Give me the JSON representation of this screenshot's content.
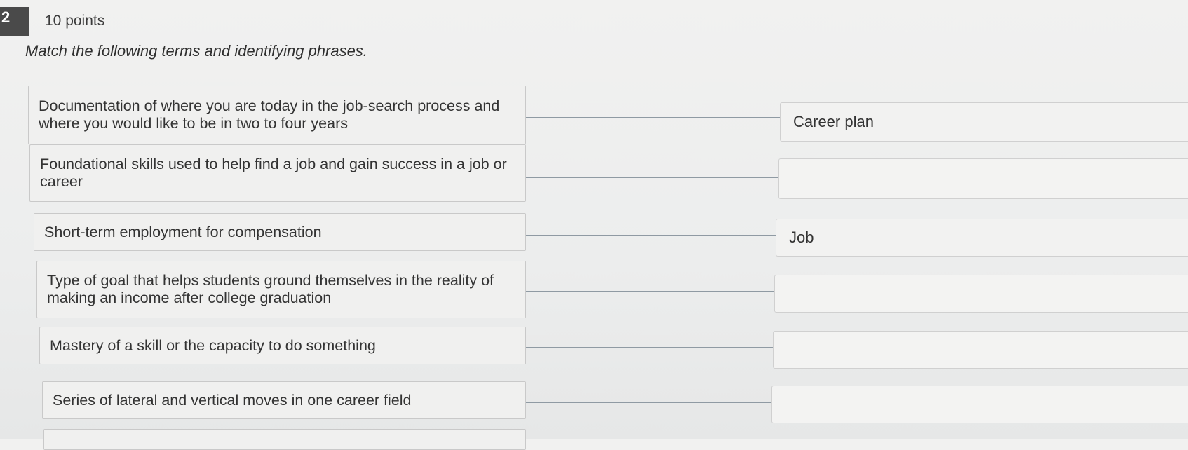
{
  "question": {
    "number": "2",
    "points_label": "10 points",
    "instructions": "Match the following terms and identifying phrases."
  },
  "matches": [
    {
      "prompt": "Documentation of where you are today in the job-search process and where you would like to be in two to four years",
      "answer": "Career plan"
    },
    {
      "prompt": "Foundational skills used to help find a job and gain success in a job or career",
      "answer": ""
    },
    {
      "prompt": "Short-term employment for compensation",
      "answer": "Job"
    },
    {
      "prompt": "Type of goal that helps students ground themselves in the reality of making an income after college graduation",
      "answer": ""
    },
    {
      "prompt": "Mastery of a skill or the capacity to do something",
      "answer": ""
    },
    {
      "prompt": "Series of lateral and vertical moves in one career field",
      "answer": ""
    }
  ]
}
